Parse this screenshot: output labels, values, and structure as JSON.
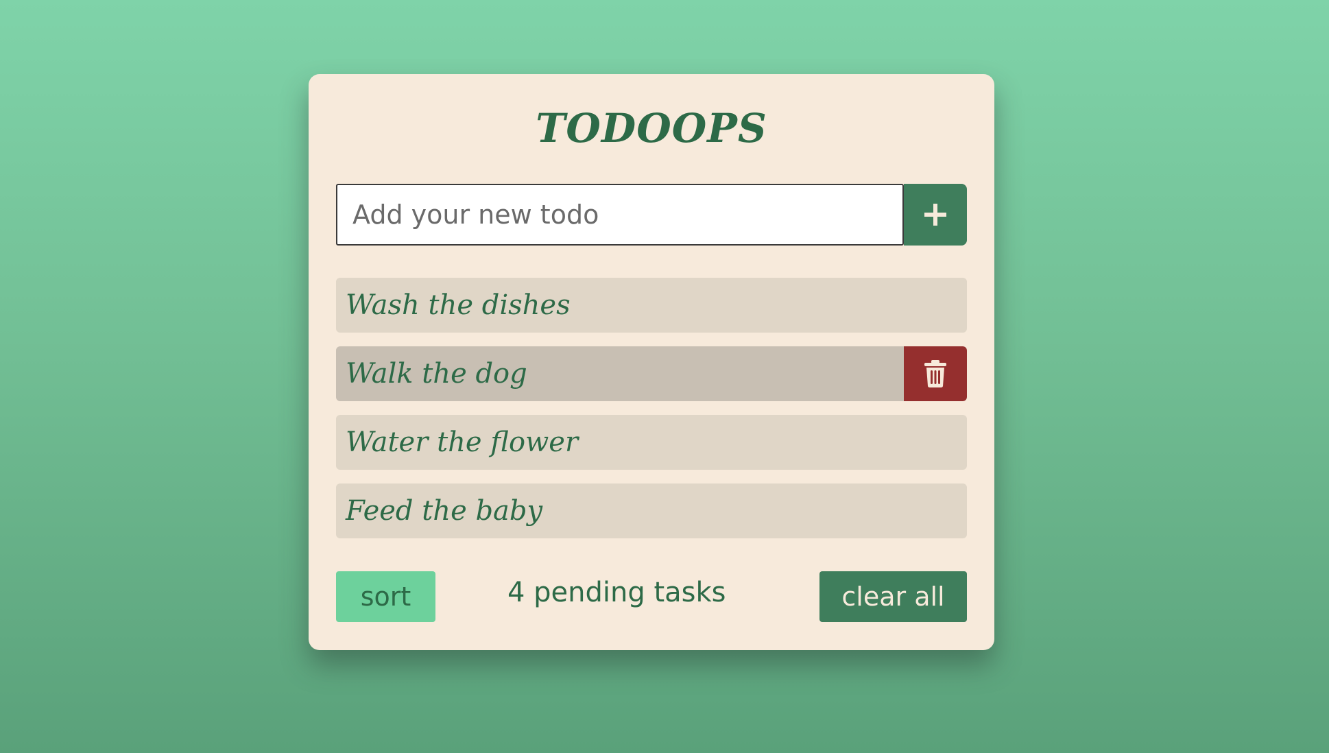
{
  "app": {
    "title": "TODOOPS"
  },
  "input": {
    "placeholder": "Add your new todo",
    "value": ""
  },
  "add_button": {
    "icon": "plus-icon"
  },
  "todos": [
    {
      "text": "Wash the dishes"
    },
    {
      "text": "Walk the dog",
      "hovered": true
    },
    {
      "text": "Water the flower"
    },
    {
      "text": "Feed the baby"
    }
  ],
  "delete_button": {
    "icon": "trash-icon"
  },
  "footer": {
    "sort_label": "sort",
    "pending_text": "4 pending tasks",
    "clear_label": "clear all"
  },
  "colors": {
    "primary": "#3f7e5c",
    "accent": "#6dd19c",
    "danger": "#952f2e",
    "card": "#f7eadb",
    "item": "#e0d6c7",
    "item_hover": "#c8bfb3",
    "text": "#2d6a47"
  }
}
